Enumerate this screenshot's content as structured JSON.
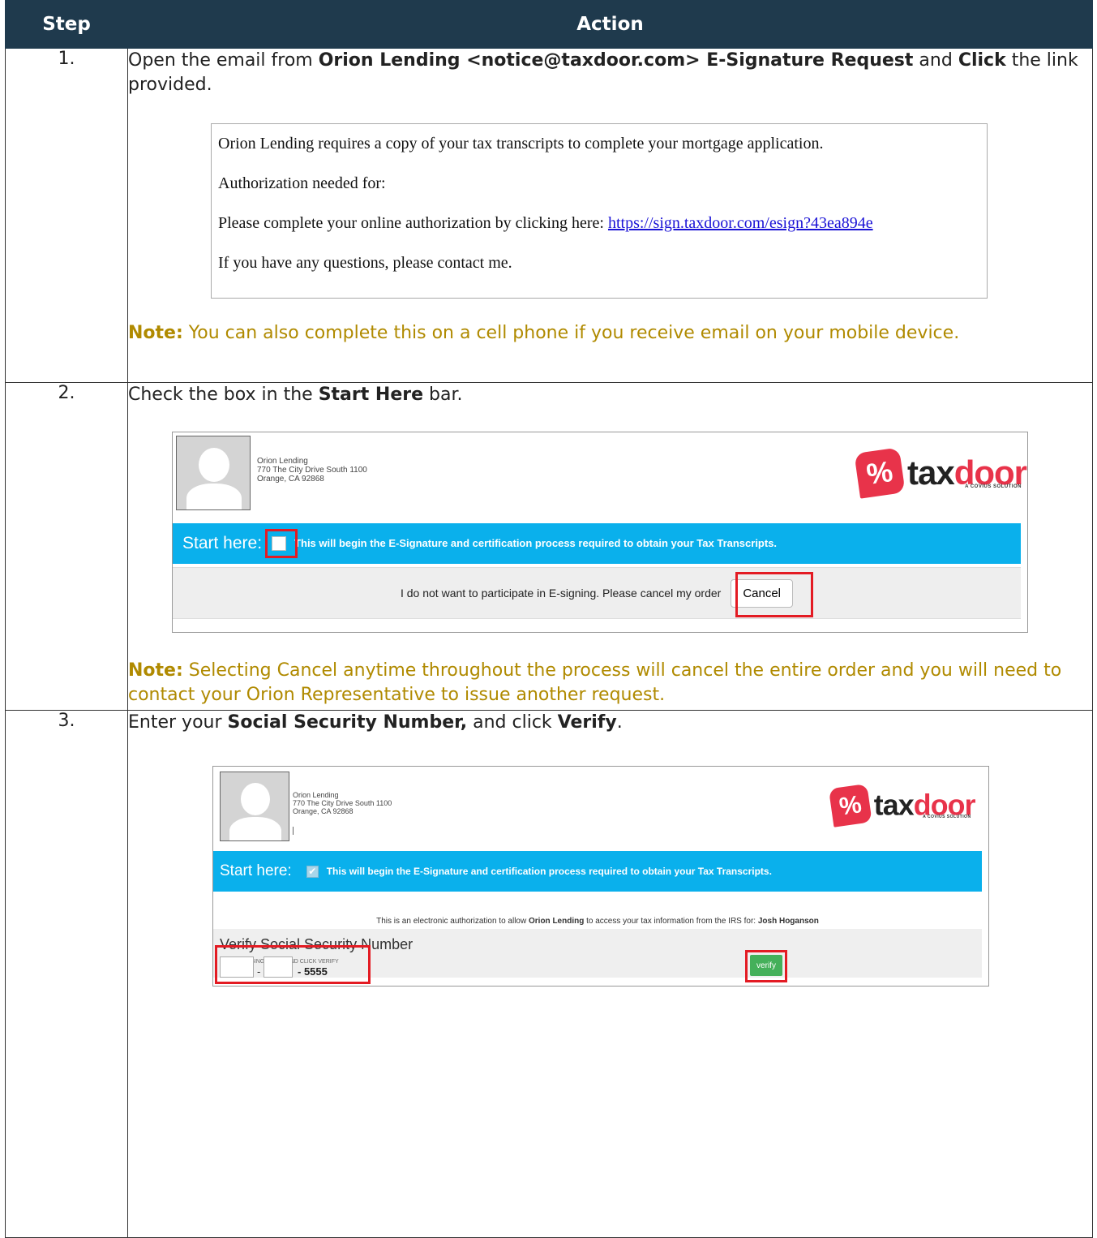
{
  "table": {
    "col_step": "Step",
    "col_action": "Action"
  },
  "step1": {
    "num": "1.",
    "t1": "Open the email from ",
    "b1": "Orion Lending <notice@taxdoor.com> E-Signature Request",
    "t2": " and ",
    "b2": "Click",
    "t3": " the link provided.",
    "email": {
      "line1": "Orion Lending requires a copy of your tax transcripts to complete your mortgage application.",
      "line2": "Authorization needed for:",
      "line3_text": "Please complete your online authorization by clicking here: ",
      "line3_link": "https://sign.taxdoor.com/esign?43ea894e",
      "line4": "If you have any questions, please contact me."
    },
    "note_label": "Note:",
    "note_text": " You can also complete this on a cell phone if you receive email on your mobile device."
  },
  "step2": {
    "num": "2.",
    "t1": "Check the box in the ",
    "b1": "Start Here",
    "t2": " bar.",
    "shot": {
      "addr1": "Orion Lending",
      "addr2": "770 The City Drive South 1100",
      "addr3": "Orange, CA 92868",
      "logo_tax": "tax",
      "logo_door": "door",
      "logo_sub": "A COVIUS SOLUTION",
      "bar_label": "Start here:",
      "bar_text": "This will begin the E-Signature and certification process required to obtain your Tax Transcripts.",
      "cancel_text": "I do not want to participate in E-signing. Please cancel my order",
      "cancel_btn": "Cancel"
    },
    "note_label": "Note:",
    "note_text": " Selecting Cancel anytime throughout the process will cancel the entire order and you will need to contact your Orion Representative to issue another request."
  },
  "step3": {
    "num": "3.",
    "t1": "Enter your ",
    "b1": "Social Security Number,",
    "t2": " and click ",
    "b2": "Verify",
    "t3": ".",
    "shot": {
      "addr1": "Orion Lending",
      "addr2": "770 The City Drive South 1100",
      "addr3": "Orange, CA 92868",
      "logo_tax": "tax",
      "logo_door": "door",
      "logo_sub": "A COVIUS SOLUTION",
      "bar_label": "Start here:",
      "bar_text": "This will begin the E-Signature and certification process required to obtain your Tax Transcripts.",
      "auth_pre": "This is an electronic authorization to allow ",
      "auth_company": "Orion Lending",
      "auth_mid": " to access your tax information from the IRS for: ",
      "auth_name": "Josh Hoganson",
      "ssn_title": "Verify Social Security Number",
      "ssn_hint": "ENTER MISSING DIGITS AND CLICK VERIFY",
      "ssn_dash": "-",
      "ssn_last": "- 5555",
      "verify_btn": "verify"
    }
  }
}
